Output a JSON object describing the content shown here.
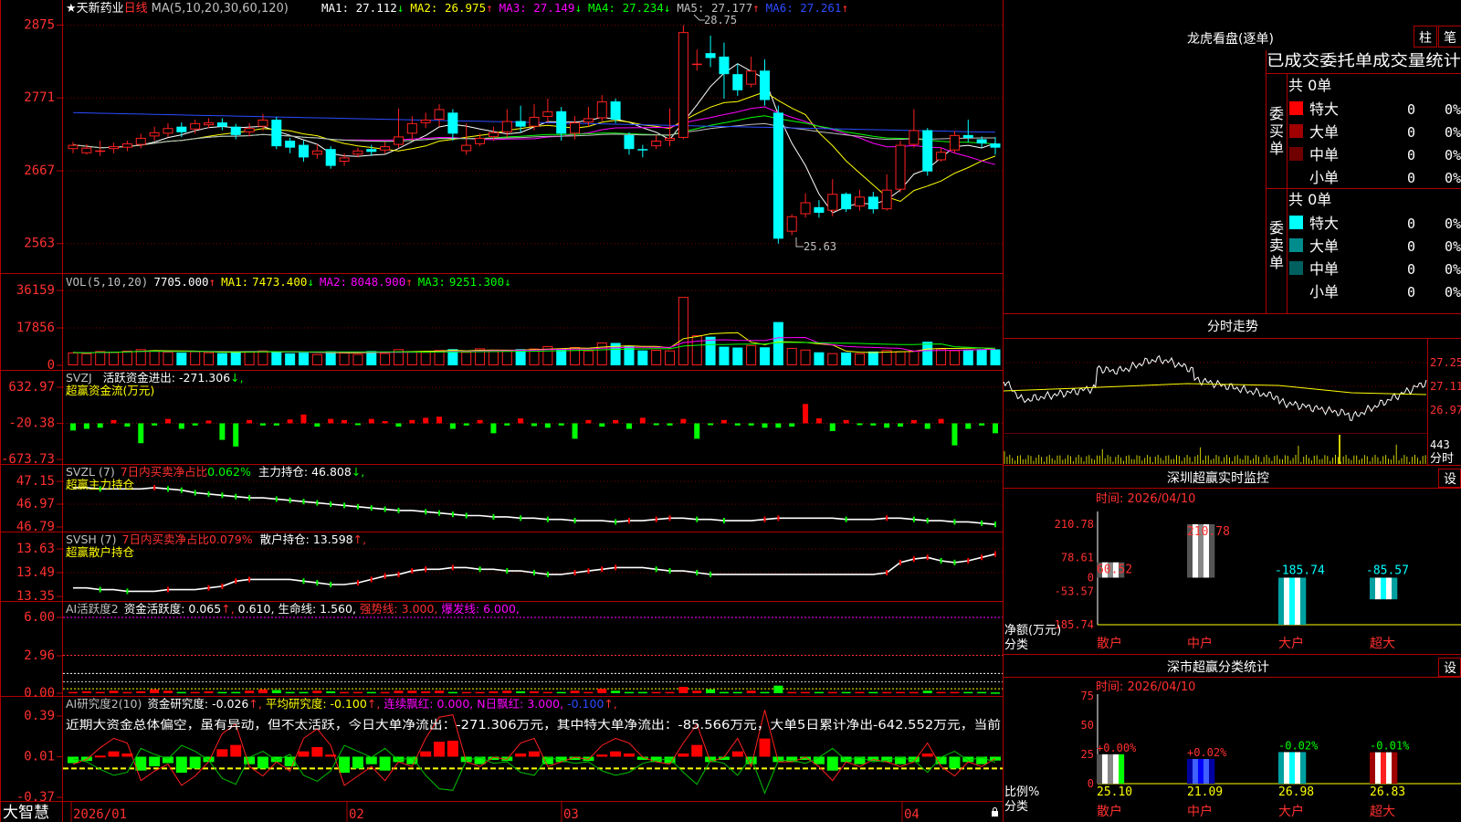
{
  "colors": {
    "up": "#ff2020",
    "down": "#00ffff",
    "frame": "#b00000",
    "ma1": "#ffffff",
    "ma2": "#ffff00",
    "ma3": "#ff00ff",
    "ma4": "#00ff00",
    "ma5": "#c0c0c0",
    "ma6": "#2b4cff",
    "grid": "#800000"
  },
  "main": {
    "stock_name": "★天新药业",
    "period": "日线",
    "ma_label": "MA(5,10,20,30,60,120)",
    "ma_values": [
      {
        "label": "MA1:",
        "value": "27.112",
        "arrow": "↓",
        "color": "#ffffff"
      },
      {
        "label": "MA2:",
        "value": "26.975",
        "arrow": "↑",
        "color": "#ffff00"
      },
      {
        "label": "MA3:",
        "value": "27.149",
        "arrow": "↓",
        "color": "#ff00ff"
      },
      {
        "label": "MA4:",
        "value": "27.234",
        "arrow": "↓",
        "color": "#00ff00"
      },
      {
        "label": "MA5:",
        "value": "27.177",
        "arrow": "↑",
        "color": "#c0c0c0"
      },
      {
        "label": "MA6:",
        "value": "27.261",
        "arrow": "↑",
        "color": "#2b4cff"
      }
    ],
    "y_ticks": [
      "2875",
      "2771",
      "2667",
      "2563"
    ],
    "high_label": "28.75",
    "low_label": "25.63"
  },
  "vol": {
    "title": "VOL(5,10,20)",
    "value": "7705.000",
    "arrow": "↑",
    "ma1": "7473.400",
    "ma1_arrow": "↓",
    "ma2": "8048.900",
    "ma2_arrow": "↑",
    "ma3": "9251.300",
    "ma3_arrow": "↓",
    "y_ticks": [
      "36159",
      "17856",
      "0"
    ]
  },
  "svzj": {
    "title": "SVZJ",
    "l1": "活跃资金进出:",
    "v1": "-271.306",
    "a1": "↓,",
    "subtitle": "超赢资金流(万元)",
    "y_ticks": [
      "632.97",
      "-20.38",
      "-673.73"
    ]
  },
  "svzl": {
    "title": "SVZL (7)",
    "l1": "7日内买卖净占比",
    "v1": "0.062%",
    "l2": "主力持仓:",
    "v2": "46.808",
    "a2": "↓,",
    "subtitle": "超赢主力持仓",
    "y_ticks": [
      "47.15",
      "46.97",
      "46.79"
    ]
  },
  "svsh": {
    "title": "SVSH (7)",
    "l1": "7日内买卖净占比",
    "v1": "0.079%",
    "l2": "散户持仓:",
    "v2": "13.598",
    "a2": "↑,",
    "subtitle": "超赢散户持仓",
    "y_ticks": [
      "13.63",
      "13.49",
      "13.35"
    ]
  },
  "ai1": {
    "title": "AI活跃度2",
    "l1": "资金活跃度:",
    "v1": "0.065",
    "a1": "↑,",
    "v2": "0.610,",
    "l3": "生命线:",
    "v3": "1.560,",
    "l4": "强势线:",
    "v4": "3.000,",
    "l5": "爆发线:",
    "v5": "6.000,",
    "y_ticks": [
      "6.00",
      "2.96",
      "0.00"
    ]
  },
  "ai2": {
    "title": "AI研究度2(10)",
    "l1": "资金研究度:",
    "v1": "-0.026",
    "a1": "↑,",
    "l2": "平均研究度:",
    "v2": "-0.100",
    "a2": "↑,",
    "l3": "连续飘红:",
    "v3": "0.000,",
    "l4": "N日飘红:",
    "v4": "3.000,",
    "v5": "-0.100",
    "a5": "↑,",
    "text": "近期大资金总体偏空，虽有异动，但不太活跃，今日大单净流出：-271.306万元，其中特大单净流出：-85.566万元，大单5日累计净出-642.552万元，当前",
    "y_ticks": [
      "0.39",
      "0.01",
      "-0.37"
    ]
  },
  "xaxis": {
    "brand": "大智慧",
    "labels": [
      "2026/01",
      "02",
      "03",
      "04"
    ]
  },
  "lhb": {
    "title": "龙虎看盘(逐单)",
    "btn1": "柱",
    "btn2": "笔",
    "header": "已成交委托单成交量统计",
    "buy": {
      "side": "委买单",
      "total": "共 0单",
      "rows": [
        {
          "name": "特大",
          "v": "0",
          "p": "0%",
          "c": "#ff0000"
        },
        {
          "name": "大单",
          "v": "0",
          "p": "0%",
          "c": "#a00000"
        },
        {
          "name": "中单",
          "v": "0",
          "p": "0%",
          "c": "#700000"
        },
        {
          "name": "小单",
          "v": "0",
          "p": "0%",
          "c": ""
        }
      ]
    },
    "sell": {
      "side": "委卖单",
      "total": "共 0单",
      "rows": [
        {
          "name": "特大",
          "v": "0",
          "p": "0%",
          "c": "#00ffff"
        },
        {
          "name": "大单",
          "v": "0",
          "p": "0%",
          "c": "#008c8c"
        },
        {
          "name": "中单",
          "v": "0",
          "p": "0%",
          "c": "#006060"
        },
        {
          "name": "小单",
          "v": "0",
          "p": "0%",
          "c": ""
        }
      ]
    }
  },
  "fenshi": {
    "title": "分时走势",
    "y_ticks": [
      "27.25",
      "27.11",
      "26.97"
    ],
    "vol_label": "443",
    "footer": "分时"
  },
  "sz_monitor": {
    "title": "深圳超赢实时监控",
    "btn": "设",
    "date": "时间: 2026/04/10",
    "y_ticks": [
      "210.78",
      "78.61",
      "0",
      "-53.57",
      "-185.74"
    ],
    "ylabel": "净额(万元)",
    "xlabel": "分类",
    "bars": [
      {
        "cat": "散户",
        "value": 60.52,
        "label": "60.52"
      },
      {
        "cat": "中户",
        "value": 210.78,
        "label": "210.78"
      },
      {
        "cat": "大户",
        "value": -185.74,
        "label": "-185.74"
      },
      {
        "cat": "超大",
        "value": -85.57,
        "label": "-85.57"
      }
    ]
  },
  "sz_class": {
    "title": "深市超赢分类统计",
    "btn": "设",
    "date": "时间: 2026/04/10",
    "y_ticks": [
      "75",
      "50",
      "25",
      "0"
    ],
    "ylabel": "比例%",
    "xlabel": "分类",
    "bars": [
      {
        "cat": "散户",
        "value": 25.1,
        "label": "25.10",
        "change": "+0.00%"
      },
      {
        "cat": "中户",
        "value": 21.09,
        "label": "21.09",
        "change": "+0.02%"
      },
      {
        "cat": "大户",
        "value": 26.98,
        "label": "26.98",
        "change": "-0.02%"
      },
      {
        "cat": "超大",
        "value": 26.83,
        "label": "26.83",
        "change": "-0.01%"
      }
    ]
  },
  "chart_data": [
    {
      "type": "candlestick",
      "title": "★天新药业 日线",
      "ylim": [
        25.3,
        28.9
      ],
      "candles": [
        [
          26.98,
          27.04,
          26.92,
          27.08
        ],
        [
          26.92,
          27.0,
          26.9,
          27.05
        ],
        [
          26.95,
          26.96,
          26.88,
          27.1
        ],
        [
          26.98,
          27.02,
          26.92,
          27.07
        ],
        [
          27.0,
          27.06,
          26.95,
          27.1
        ],
        [
          27.04,
          27.14,
          26.99,
          27.2
        ],
        [
          27.16,
          27.22,
          27.1,
          27.3
        ],
        [
          27.2,
          27.28,
          27.15,
          27.35
        ],
        [
          27.3,
          27.22,
          27.15,
          27.36
        ],
        [
          27.26,
          27.35,
          27.2,
          27.4
        ],
        [
          27.32,
          27.36,
          27.28,
          27.42
        ],
        [
          27.36,
          27.3,
          27.25,
          27.42
        ],
        [
          27.3,
          27.18,
          27.12,
          27.34
        ],
        [
          27.22,
          27.28,
          27.16,
          27.35
        ],
        [
          27.3,
          27.4,
          27.24,
          27.48
        ],
        [
          27.4,
          27.02,
          26.98,
          27.44
        ],
        [
          27.1,
          27.0,
          26.92,
          27.14
        ],
        [
          27.04,
          26.86,
          26.8,
          27.1
        ],
        [
          26.9,
          26.96,
          26.84,
          27.05
        ],
        [
          26.98,
          26.74,
          26.7,
          27.02
        ],
        [
          26.8,
          26.86,
          26.74,
          26.92
        ],
        [
          26.9,
          26.96,
          26.86,
          27.0
        ],
        [
          26.98,
          26.94,
          26.88,
          27.04
        ],
        [
          26.96,
          27.02,
          26.92,
          27.08
        ],
        [
          27.04,
          27.16,
          27.0,
          27.56
        ],
        [
          27.2,
          27.35,
          27.1,
          27.45
        ],
        [
          27.35,
          27.4,
          27.28,
          27.5
        ],
        [
          27.4,
          27.55,
          27.3,
          27.62
        ],
        [
          27.5,
          27.2,
          27.1,
          27.55
        ],
        [
          26.95,
          27.04,
          26.9,
          27.35
        ],
        [
          27.05,
          27.14,
          27.02,
          27.2
        ],
        [
          27.15,
          27.22,
          27.1,
          27.3
        ],
        [
          27.22,
          27.38,
          27.15,
          27.55
        ],
        [
          27.38,
          27.3,
          27.22,
          27.6
        ],
        [
          27.3,
          27.44,
          27.25,
          27.62
        ],
        [
          27.44,
          27.52,
          27.36,
          27.7
        ],
        [
          27.52,
          27.2,
          27.1,
          27.58
        ],
        [
          27.2,
          27.36,
          27.12,
          27.45
        ],
        [
          27.36,
          27.42,
          27.3,
          27.58
        ],
        [
          27.42,
          27.66,
          27.38,
          27.75
        ],
        [
          27.66,
          27.4,
          27.35,
          27.7
        ],
        [
          27.18,
          26.98,
          26.9,
          27.22
        ],
        [
          26.98,
          26.96,
          26.86,
          27.04
        ],
        [
          27.02,
          27.1,
          26.98,
          27.18
        ],
        [
          27.1,
          27.14,
          27.02,
          27.56
        ],
        [
          27.14,
          28.65,
          27.12,
          28.75
        ],
        [
          28.2,
          28.2,
          28.1,
          28.4
        ],
        [
          28.35,
          28.28,
          28.15,
          28.6
        ],
        [
          28.3,
          28.05,
          27.7,
          28.5
        ],
        [
          28.05,
          27.82,
          27.74,
          28.2
        ],
        [
          27.9,
          28.1,
          27.86,
          28.3
        ],
        [
          28.1,
          27.68,
          27.6,
          28.26
        ],
        [
          27.5,
          25.7,
          25.63,
          27.6
        ],
        [
          25.8,
          26.02,
          25.75,
          26.05
        ],
        [
          26.05,
          26.22,
          26.0,
          26.35
        ],
        [
          26.15,
          26.07,
          26.0,
          26.25
        ],
        [
          26.1,
          26.34,
          26.02,
          26.55
        ],
        [
          26.34,
          26.12,
          26.08,
          26.36
        ],
        [
          26.16,
          26.3,
          26.1,
          26.4
        ],
        [
          26.3,
          26.12,
          26.06,
          26.37
        ],
        [
          26.12,
          26.4,
          26.1,
          26.62
        ],
        [
          26.4,
          27.04,
          26.36,
          27.1
        ],
        [
          27.04,
          27.25,
          27.0,
          27.55
        ],
        [
          27.25,
          26.66,
          26.6,
          27.28
        ],
        [
          26.82,
          26.94,
          26.8,
          27.0
        ],
        [
          26.96,
          27.18,
          26.92,
          27.24
        ],
        [
          27.18,
          27.14,
          27.08,
          27.4
        ],
        [
          27.12,
          27.06,
          27.0,
          27.16
        ],
        [
          27.06,
          27.0,
          26.9,
          27.15
        ]
      ]
    },
    {
      "type": "bar",
      "title": "VOL(5,10,20)",
      "ylim": [
        0,
        36159
      ],
      "values": [
        6200,
        5800,
        6900,
        6400,
        7100,
        7800,
        7200,
        6600,
        6100,
        6800,
        6300,
        5900,
        6400,
        6700,
        7200,
        6500,
        5800,
        6100,
        5400,
        6800,
        6200,
        5500,
        6900,
        6000,
        7800,
        6800,
        6500,
        7400,
        7800,
        6500,
        8200,
        6900,
        7200,
        7800,
        8100,
        9300,
        7900,
        8800,
        7200,
        11000,
        10800,
        9400,
        7200,
        7500,
        7200,
        33000,
        14500,
        13800,
        9000,
        8600,
        9800,
        8700,
        20900,
        8400,
        7600,
        6300,
        5900,
        6200,
        5800,
        6700,
        7400,
        6800,
        7100,
        11400,
        8100,
        7300,
        7600,
        7800,
        7700
      ]
    },
    {
      "type": "bar",
      "title": "SVZJ",
      "ylim": [
        -673.73,
        632.97
      ],
      "values": [
        -150,
        -120,
        -100,
        40,
        -80,
        -380,
        -60,
        60,
        -120,
        -60,
        30,
        -320,
        -440,
        40,
        -60,
        -60,
        50,
        140,
        -80,
        60,
        40,
        -50,
        60,
        20,
        -80,
        40,
        80,
        100,
        -120,
        -60,
        40,
        -200,
        -60,
        70,
        -70,
        -100,
        -60,
        -300,
        40,
        -80,
        40,
        -120,
        80,
        -40,
        -60,
        60,
        -300,
        -50,
        40,
        -60,
        -60,
        -100,
        -100,
        -80,
        330,
        70,
        -160,
        40,
        -50,
        -60,
        -100,
        -80,
        40,
        -120,
        60,
        -420,
        -120,
        -60,
        -200
      ]
    },
    {
      "type": "line",
      "title": "SVZL",
      "ylim": [
        46.79,
        47.15
      ],
      "values": [
        47.1,
        47.1,
        47.09,
        47.09,
        47.09,
        47.09,
        47.1,
        47.09,
        47.08,
        47.06,
        47.05,
        47.04,
        47.03,
        47.02,
        47.02,
        47.01,
        47.0,
        46.99,
        46.98,
        46.97,
        46.96,
        46.95,
        46.94,
        46.93,
        46.92,
        46.92,
        46.91,
        46.9,
        46.89,
        46.88,
        46.88,
        46.87,
        46.87,
        46.86,
        46.86,
        46.85,
        46.85,
        46.84,
        46.84,
        46.84,
        46.83,
        46.84,
        46.84,
        46.85,
        46.86,
        46.86,
        46.85,
        46.85,
        46.84,
        46.84,
        46.84,
        46.85,
        46.86,
        46.86,
        46.86,
        46.86,
        46.86,
        46.85,
        46.85,
        46.85,
        46.86,
        46.86,
        46.85,
        46.84,
        46.84,
        46.83,
        46.83,
        46.82,
        46.81
      ]
    },
    {
      "type": "line",
      "title": "SVSH",
      "ylim": [
        13.35,
        13.63
      ],
      "values": [
        13.4,
        13.4,
        13.39,
        13.39,
        13.38,
        13.38,
        13.38,
        13.39,
        13.39,
        13.39,
        13.4,
        13.41,
        13.44,
        13.45,
        13.45,
        13.45,
        13.45,
        13.44,
        13.43,
        13.42,
        13.42,
        13.43,
        13.45,
        13.47,
        13.48,
        13.5,
        13.51,
        13.51,
        13.52,
        13.52,
        13.51,
        13.51,
        13.5,
        13.5,
        13.49,
        13.48,
        13.48,
        13.49,
        13.5,
        13.51,
        13.52,
        13.52,
        13.52,
        13.51,
        13.5,
        13.5,
        13.49,
        13.48,
        13.48,
        13.48,
        13.48,
        13.48,
        13.48,
        13.48,
        13.48,
        13.48,
        13.48,
        13.48,
        13.48,
        13.48,
        13.49,
        13.55,
        13.57,
        13.58,
        13.56,
        13.55,
        13.56,
        13.58,
        13.6
      ]
    },
    {
      "type": "bar",
      "title": "AI活跃度2",
      "ylim": [
        0,
        6
      ],
      "values": [
        0.1,
        0.15,
        0.1,
        0.2,
        0.1,
        0.15,
        0.3,
        0.2,
        0.1,
        0.1,
        0.15,
        0.1,
        0.1,
        0.2,
        0.3,
        0.25,
        0.1,
        0.1,
        0.2,
        0.15,
        0.1,
        0.1,
        0.1,
        0.1,
        0.2,
        0.2,
        0.15,
        0.2,
        0.1,
        0.1,
        0.1,
        0.15,
        0.2,
        0.15,
        0.15,
        0.1,
        0.1,
        0.2,
        0.1,
        0.35,
        0.2,
        0.1,
        0.1,
        0.1,
        0.1,
        0.5,
        0.2,
        0.3,
        0.1,
        0.1,
        0.2,
        0.1,
        0.6,
        0.1,
        0.1,
        0.1,
        0.1,
        0.1,
        0.1,
        0.1,
        0.1,
        0.1,
        0.1,
        0.2,
        0.1,
        0.1,
        0.1,
        0.1,
        0.065
      ]
    },
    {
      "type": "bar",
      "title": "AI研究度2(10)",
      "ylim": [
        -0.37,
        0.39
      ],
      "values": [
        -0.05,
        -0.03,
        0.02,
        0.06,
        0.04,
        -0.12,
        -0.08,
        -0.05,
        -0.14,
        -0.1,
        -0.04,
        0.08,
        0.12,
        -0.06,
        -0.1,
        -0.04,
        -0.08,
        0.06,
        0.1,
        0.03,
        -0.14,
        -0.1,
        -0.06,
        -0.12,
        -0.04,
        -0.06,
        0.06,
        0.15,
        0.16,
        -0.04,
        -0.06,
        -0.02,
        -0.03,
        0.04,
        0.06,
        -0.06,
        -0.04,
        -0.02,
        -0.03,
        0.03,
        0.06,
        0.04,
        -0.02,
        -0.04,
        -0.05,
        0.04,
        0.12,
        -0.04,
        -0.02,
        0.06,
        -0.06,
        0.18,
        -0.04,
        -0.04,
        -0.02,
        -0.06,
        -0.12,
        -0.04,
        -0.06,
        -0.03,
        -0.04,
        -0.06,
        -0.04,
        0.04,
        -0.06,
        -0.1,
        -0.04,
        -0.06,
        -0.026
      ]
    }
  ]
}
